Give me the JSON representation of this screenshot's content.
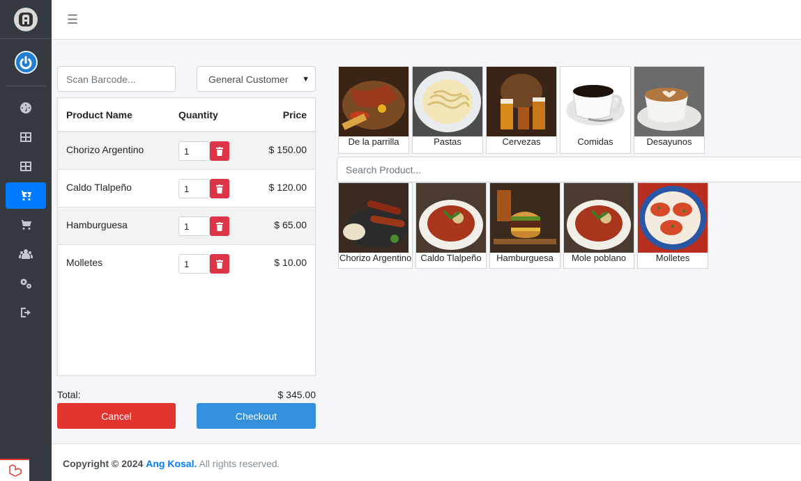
{
  "topbar": {
    "menu_icon": "hamburger-icon"
  },
  "sidebar": {
    "nav_icons": [
      "dashboard-icon",
      "products-icon",
      "categories-icon",
      "pos-cart-icon",
      "orders-cart-icon",
      "customers-icon",
      "settings-icon",
      "logout-icon"
    ],
    "active_index": 3
  },
  "pos": {
    "barcode_placeholder": "Scan Barcode...",
    "customer_selected": "General Customer",
    "columns": {
      "name": "Product Name",
      "quantity": "Quantity",
      "price": "Price"
    },
    "cart_items": [
      {
        "name": "Chorizo Argentino",
        "quantity": "1",
        "price": "$ 150.00"
      },
      {
        "name": "Caldo Tlalpeño",
        "quantity": "1",
        "price": "$ 120.00"
      },
      {
        "name": "Hamburguesa",
        "quantity": "1",
        "price": "$ 65.00"
      },
      {
        "name": "Molletes",
        "quantity": "1",
        "price": "$ 10.00"
      }
    ],
    "total_label": "Total:",
    "total_value": "$ 345.00",
    "cancel_label": "Cancel",
    "checkout_label": "Checkout"
  },
  "categories": [
    {
      "label": "De la parrilla"
    },
    {
      "label": "Pastas"
    },
    {
      "label": "Cervezas"
    },
    {
      "label": "Comidas"
    },
    {
      "label": "Desayunos"
    }
  ],
  "product_search_placeholder": "Search Product...",
  "products": [
    {
      "label": "Chorizo Argentino"
    },
    {
      "label": "Caldo Tlalpeño"
    },
    {
      "label": "Hamburguesa"
    },
    {
      "label": "Mole poblano"
    },
    {
      "label": "Molletes"
    }
  ],
  "footer": {
    "prefix": "Copyright © 2024",
    "brand": "Ang Kosal.",
    "suffix": "All rights reserved."
  },
  "colors": {
    "sidebar": "#343a40",
    "active_nav": "#007bff",
    "delete_button": "#dc3545",
    "cancel_button": "#e3342f",
    "checkout_button": "#3490dc"
  }
}
